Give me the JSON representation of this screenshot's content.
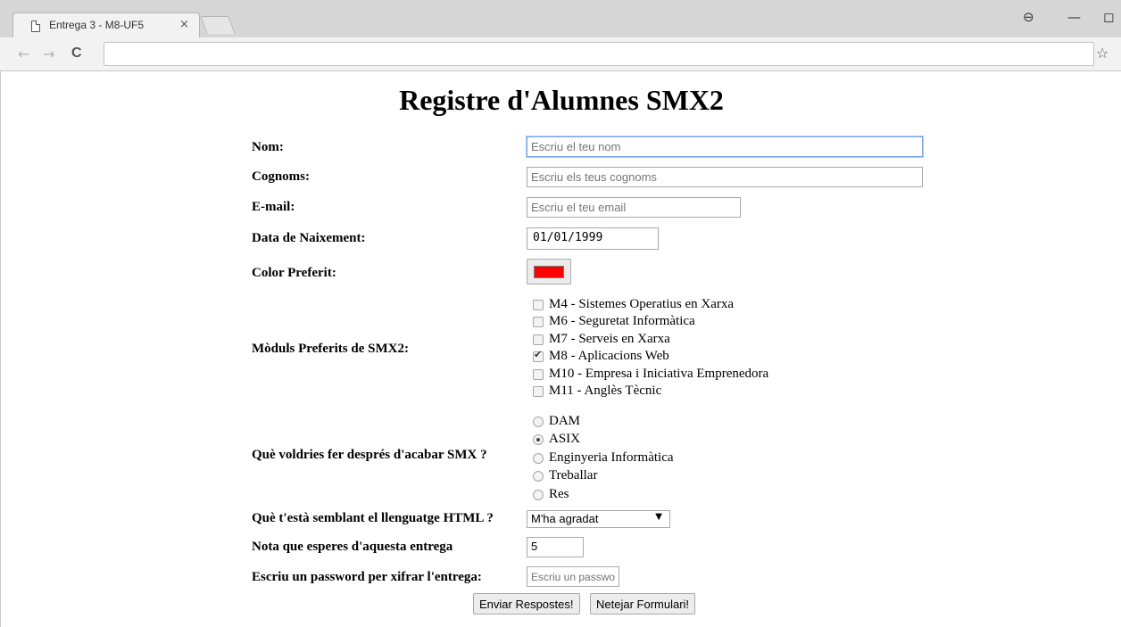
{
  "browser": {
    "tab_title": "Entrega 3 - M8-UF5",
    "tab_close": "×",
    "back": "←",
    "forward": "→",
    "reload": "C",
    "star": "☆",
    "profile": "⊖",
    "minimize": "—",
    "restore": "◻"
  },
  "form": {
    "title": "Registre d'Alumnes SMX2",
    "nom": {
      "label": "Nom:",
      "placeholder": "Escriu el teu nom"
    },
    "cognoms": {
      "label": "Cognoms:",
      "placeholder": "Escriu els teus cognoms"
    },
    "email": {
      "label": "E-mail:",
      "placeholder": "Escriu el teu email"
    },
    "naixement": {
      "label": "Data de Naixement:",
      "value": "01/01/1999"
    },
    "color": {
      "label": "Color Preferit:",
      "value": "#ff0000"
    },
    "moduls": {
      "label": "Mòduls Preferits de SMX2:",
      "options": [
        {
          "text": "M4 - Sistemes Operatius en Xarxa",
          "checked": false
        },
        {
          "text": "M6 - Seguretat Informàtica",
          "checked": false
        },
        {
          "text": "M7 - Serveis en Xarxa",
          "checked": false
        },
        {
          "text": "M8 - Aplicacions Web",
          "checked": true
        },
        {
          "text": "M10 - Empresa i Iniciativa Emprenedora",
          "checked": false
        },
        {
          "text": "M11 - Anglès Tècnic",
          "checked": false
        }
      ]
    },
    "futur": {
      "label": "Què voldries fer després d'acabar SMX ?",
      "options": [
        {
          "text": "DAM",
          "checked": false
        },
        {
          "text": "ASIX",
          "checked": true
        },
        {
          "text": "Enginyeria Informàtica",
          "checked": false
        },
        {
          "text": "Treballar",
          "checked": false
        },
        {
          "text": "Res",
          "checked": false
        }
      ]
    },
    "html_opinio": {
      "label": "Què t'està semblant el llenguatge HTML ?",
      "value": "M'ha agradat",
      "arrow": "▼"
    },
    "nota": {
      "label": "Nota que esperes d'aquesta entrega",
      "value": "5"
    },
    "password": {
      "label": "Escriu un password per xifrar l'entrega:",
      "placeholder": "Escriu un password"
    },
    "submit_label": "Enviar Respostes!",
    "reset_label": "Netejar Formulari!"
  }
}
